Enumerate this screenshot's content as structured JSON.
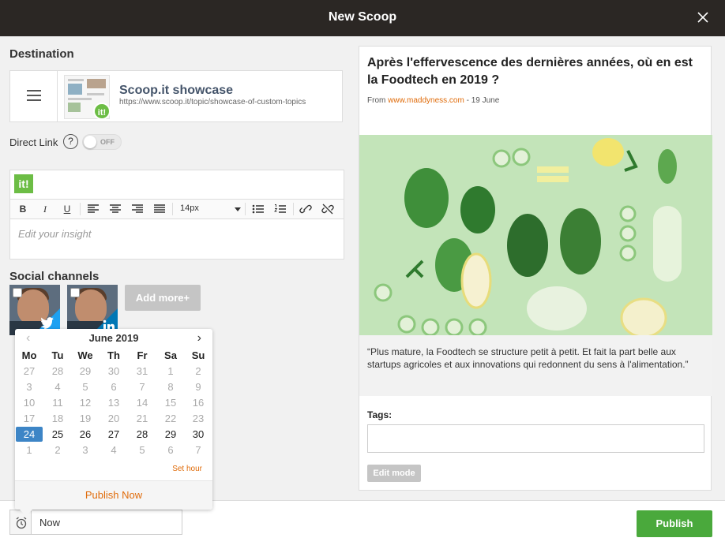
{
  "window": {
    "title": "New Scoop"
  },
  "destination": {
    "section_title": "Destination",
    "topic_name": "Scoop.it showcase",
    "topic_url": "https://www.scoop.it/topic/showcase-of-custom-topics",
    "thumb_logo": "it!"
  },
  "direct_link": {
    "label": "Direct Link",
    "help": "?",
    "toggle_state": "OFF"
  },
  "editor": {
    "brand_logo": "it!",
    "toolbar": {
      "bold": "B",
      "italic": "I",
      "underline": "U",
      "font_size": "14px"
    },
    "placeholder": "Edit your insight"
  },
  "social": {
    "section_title": "Social channels",
    "channels": [
      {
        "network": "twitter-icon",
        "color": "#1da1f2"
      },
      {
        "network": "linkedin-icon",
        "color": "#0077b5"
      }
    ],
    "add_more_label": "Add more+"
  },
  "datepicker": {
    "month_label": "June 2019",
    "prev": "‹",
    "next": "›",
    "weekdays": [
      "Mo",
      "Tu",
      "We",
      "Th",
      "Fr",
      "Sa",
      "Su"
    ],
    "weeks": [
      [
        "27",
        "28",
        "29",
        "30",
        "31",
        "1",
        "2"
      ],
      [
        "3",
        "4",
        "5",
        "6",
        "7",
        "8",
        "9"
      ],
      [
        "10",
        "11",
        "12",
        "13",
        "14",
        "15",
        "16"
      ],
      [
        "17",
        "18",
        "19",
        "20",
        "21",
        "22",
        "23"
      ],
      [
        "24",
        "25",
        "26",
        "27",
        "28",
        "29",
        "30"
      ],
      [
        "1",
        "2",
        "3",
        "4",
        "5",
        "6",
        "7"
      ]
    ],
    "selected_day": "24",
    "set_hour_label": "Set hour",
    "publish_now_label": "Publish Now"
  },
  "footer": {
    "when_value": "Now",
    "publish_label": "Publish"
  },
  "article": {
    "headline": "Après l'effervescence des dernières années, où en est la Foodtech en 2019 ?",
    "from_label": "From",
    "source": "www.maddyness.com",
    "date": "- 19 June",
    "quote": "“Plus mature, la Foodtech se structure petit à petit. Et fait la part belle aux startups agricoles et aux innovations qui redonnent du sens à l'al­imentation.”",
    "tags_label": "Tags:",
    "edit_mode_label": "Edit mode"
  },
  "colors": {
    "title_bar": "#2b2724",
    "accent_orange": "#e06c0b",
    "brand_green": "#6cbd45",
    "publish_green": "#4aa93c",
    "selected_blue": "#3d85c6"
  }
}
